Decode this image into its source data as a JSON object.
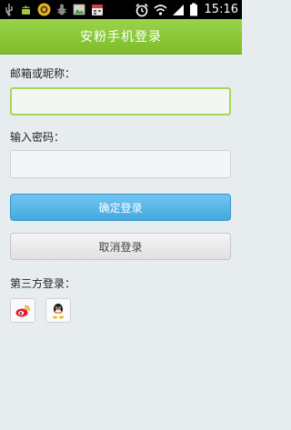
{
  "status_bar": {
    "time": "15:16",
    "icons": [
      "usb-icon",
      "android-icon",
      "app-icon",
      "bug-icon",
      "photo-icon",
      "calendar-icon",
      "alarm-clock-icon",
      "wifi-icon",
      "signal-icon",
      "battery-icon"
    ]
  },
  "header": {
    "title": "安粉手机登录"
  },
  "form": {
    "email_label": "邮箱或昵称：",
    "email_value": "",
    "password_label": "输入密码：",
    "password_value": "",
    "confirm_label": "确定登录",
    "cancel_label": "取消登录"
  },
  "third_party": {
    "label": "第三方登录：",
    "providers": [
      "weibo",
      "qq"
    ]
  },
  "colors": {
    "header_green": "#8cc63f",
    "primary_blue": "#4aa9e0",
    "background": "#e7ecef"
  }
}
